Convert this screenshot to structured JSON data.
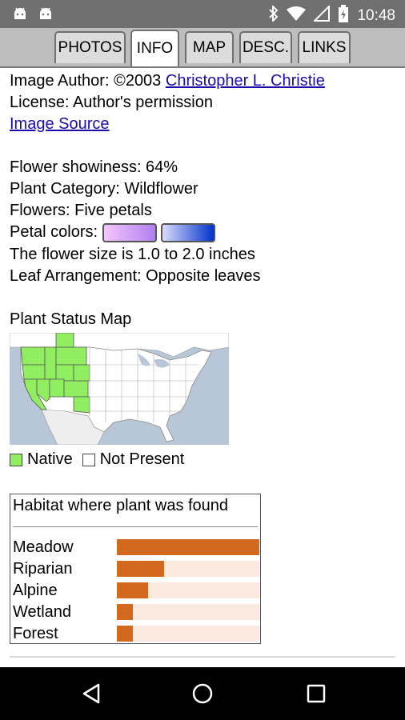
{
  "status_bar": {
    "time": "10:48",
    "icons": [
      "android-icon",
      "android-icon",
      "bluetooth-icon",
      "wifi-icon",
      "signal-icon",
      "battery-icon"
    ]
  },
  "tabs": [
    {
      "label": "PHOTOS",
      "active": false
    },
    {
      "label": "INFO",
      "active": true
    },
    {
      "label": "MAP",
      "active": false
    },
    {
      "label": "DESC.",
      "active": false
    },
    {
      "label": "LINKS",
      "active": false
    }
  ],
  "info": {
    "author_prefix": "Image Author: ©2003 ",
    "author_name": "Christopher L. Christie",
    "license": "License: Author's permission",
    "image_source": "Image Source",
    "showiness": "Flower showiness: 64%",
    "category": "Plant Category: Wildflower",
    "flowers": "Flowers: Five petals",
    "petal_colors_label": "Petal colors:",
    "petal_colors": [
      {
        "from": "#f2c6fb",
        "to": "#b37ff3"
      },
      {
        "from": "#dcdcfb",
        "to": "#0033cc"
      }
    ],
    "flower_size": "The flower size is 1.0 to 2.0 inches",
    "leaf_arrangement": "Leaf Arrangement: Opposite leaves"
  },
  "map": {
    "title": "Plant Status Map",
    "native_color": "#90ee60",
    "legend_native": "Native",
    "legend_not_present": "Not Present"
  },
  "habitat": {
    "title": "Habitat where plant was found",
    "rows": [
      {
        "label": "Meadow",
        "value": 1.0
      },
      {
        "label": "Riparian",
        "value": 0.33
      },
      {
        "label": "Alpine",
        "value": 0.22
      },
      {
        "label": "Wetland",
        "value": 0.11
      },
      {
        "label": "Forest",
        "value": 0.11
      }
    ]
  },
  "nav": {
    "buttons": [
      "back-icon",
      "home-icon",
      "recents-icon"
    ]
  }
}
